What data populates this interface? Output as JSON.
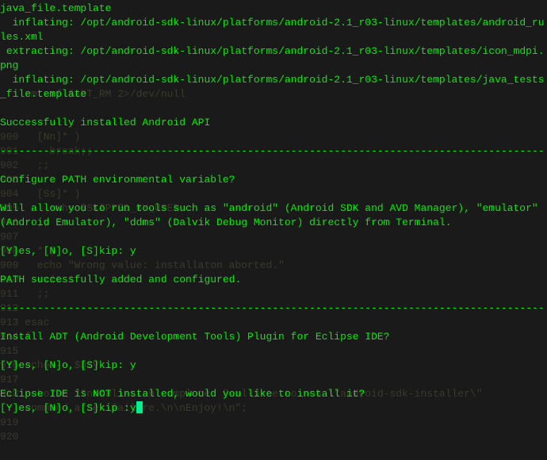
{
  "background": {
    "lines": [
      "",
      "",
      "",
      "",
      "    rm -rf $ADT_RM 2>/dev/null",
      "",
      "",
      "900   [Nn]* )",
      "901     break;;",
      "902   ;;",
      "903",
      "904   [Ss]* )",
      "905     echo $SKIPPED_BY_USER",
      "906   ;;",
      "907",
      "908   * )",
      "909   echo \"Wrong value: installaton aborted.\"",
      "910   exit 1",
      "911   ;;",
      "912",
      "913 esac",
      "914 fi",
      "915",
      "916 echo -e $DIV",
      "917",
      "918 echo -e \"Installation complete. Feel free to run \\\"android-sdk-installer\\\"",
      "    command after failure.\\n\\nEnjoy!\\n\";",
      "919",
      "920"
    ]
  },
  "foreground": {
    "lines": [
      {
        "type": "text",
        "value": "java_file.template"
      },
      {
        "type": "text",
        "value": "  inflating: /opt/android-sdk-linux/platforms/android-2.1_r03-linux/templates/android_rules.xml"
      },
      {
        "type": "text",
        "value": " extracting: /opt/android-sdk-linux/platforms/android-2.1_r03-linux/templates/icon_mdpi.png"
      },
      {
        "type": "text",
        "value": "  inflating: /opt/android-sdk-linux/platforms/android-2.1_r03-linux/templates/java_tests_file.template"
      },
      {
        "type": "blank"
      },
      {
        "type": "text",
        "value": "Successfully installed Android API"
      },
      {
        "type": "blank"
      },
      {
        "type": "divider"
      },
      {
        "type": "blank"
      },
      {
        "type": "text",
        "value": "Configure PATH environmental variable?"
      },
      {
        "type": "blank"
      },
      {
        "type": "text",
        "value": "Will allow you to run tools such as \"android\" (Android SDK and AVD Manager), \"emulator\" (Android Emulator), \"ddms\" (Dalvik Debug Monitor) directly from Terminal."
      },
      {
        "type": "blank"
      },
      {
        "type": "text",
        "value": "[Y]es, [N]o, [S]kip: y"
      },
      {
        "type": "blank"
      },
      {
        "type": "text",
        "value": "PATH successfully added and configured."
      },
      {
        "type": "blank"
      },
      {
        "type": "divider"
      },
      {
        "type": "blank"
      },
      {
        "type": "text",
        "value": "Install ADT (Android Development Tools) Plugin for Eclipse IDE?"
      },
      {
        "type": "blank"
      },
      {
        "type": "text",
        "value": "[Y]es, [N]o, [S]kip: y"
      },
      {
        "type": "blank"
      },
      {
        "type": "text",
        "value": "Eclipse IDE is NOT installed, would you like to install it?"
      },
      {
        "type": "prompt",
        "value": "[Y]es, [N]o, [S]kip :y"
      }
    ]
  },
  "divider_char": "----------------------------------------------------------------------------------------"
}
